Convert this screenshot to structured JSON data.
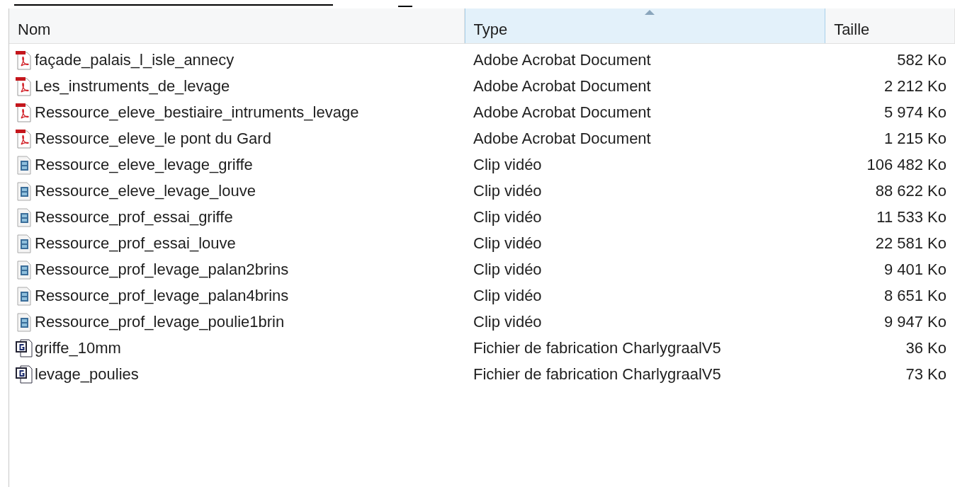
{
  "table": {
    "columns": [
      {
        "label": "Nom",
        "selected": false
      },
      {
        "label": "Type",
        "selected": true
      },
      {
        "label": "Taille",
        "selected": false
      }
    ],
    "rows": [
      {
        "kind": "pdf",
        "name": "façade_palais_l_isle_annecy",
        "type": "Adobe Acrobat Document",
        "size": "582 Ko"
      },
      {
        "kind": "pdf",
        "name": "Les_instruments_de_levage",
        "type": "Adobe Acrobat Document",
        "size": "2 212 Ko"
      },
      {
        "kind": "pdf",
        "name": "Ressource_eleve_bestiaire_intruments_levage",
        "type": "Adobe Acrobat Document",
        "size": "5 974 Ko"
      },
      {
        "kind": "pdf",
        "name": "Ressource_eleve_le pont du Gard",
        "type": "Adobe Acrobat Document",
        "size": "1 215 Ko"
      },
      {
        "kind": "video",
        "name": "Ressource_eleve_levage_griffe",
        "type": "Clip vidéo",
        "size": "106 482 Ko"
      },
      {
        "kind": "video",
        "name": "Ressource_eleve_levage_louve",
        "type": "Clip vidéo",
        "size": "88 622 Ko"
      },
      {
        "kind": "video",
        "name": "Ressource_prof_essai_griffe",
        "type": "Clip vidéo",
        "size": "11 533 Ko"
      },
      {
        "kind": "video",
        "name": "Ressource_prof_essai_louve",
        "type": "Clip vidéo",
        "size": "22 581 Ko"
      },
      {
        "kind": "video",
        "name": "Ressource_prof_levage_palan2brins",
        "type": "Clip vidéo",
        "size": "9 401 Ko"
      },
      {
        "kind": "video",
        "name": "Ressource_prof_levage_palan4brins",
        "type": "Clip vidéo",
        "size": "8 651 Ko"
      },
      {
        "kind": "video",
        "name": "Ressource_prof_levage_poulie1brin",
        "type": "Clip vidéo",
        "size": "9 947 Ko"
      },
      {
        "kind": "cnc",
        "name": "griffe_10mm",
        "type": "Fichier de fabrication CharlygraalV5",
        "size": "36 Ko"
      },
      {
        "kind": "cnc",
        "name": "levage_poulies",
        "type": "Fichier de fabrication CharlygraalV5",
        "size": "73 Ko"
      }
    ]
  }
}
